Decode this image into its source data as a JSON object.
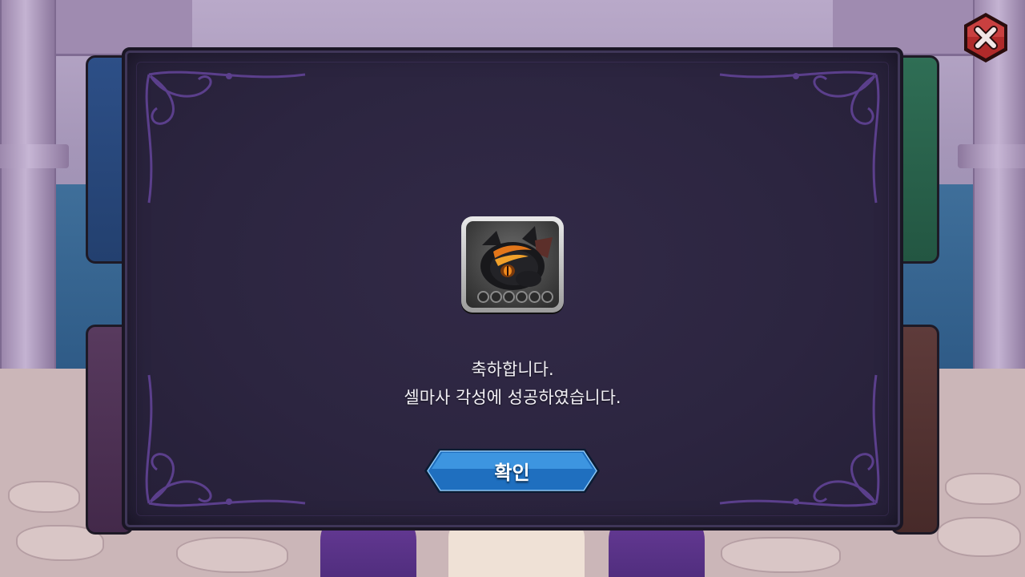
{
  "dialog": {
    "message_line1": "축하합니다.",
    "message_line2": "셀마사 각성에 성공하였습니다.",
    "confirm_label": "확인"
  },
  "reward": {
    "icon": "dragon-portrait-icon",
    "star_slots": 6
  },
  "controls": {
    "close_icon": "close-icon"
  },
  "colors": {
    "dialog_bg": "#2c2540",
    "button_blue": "#1f6fbf",
    "close_red": "#b02a2a",
    "ornament_purple": "#5b3f8c",
    "text": "#f3f1f6"
  }
}
